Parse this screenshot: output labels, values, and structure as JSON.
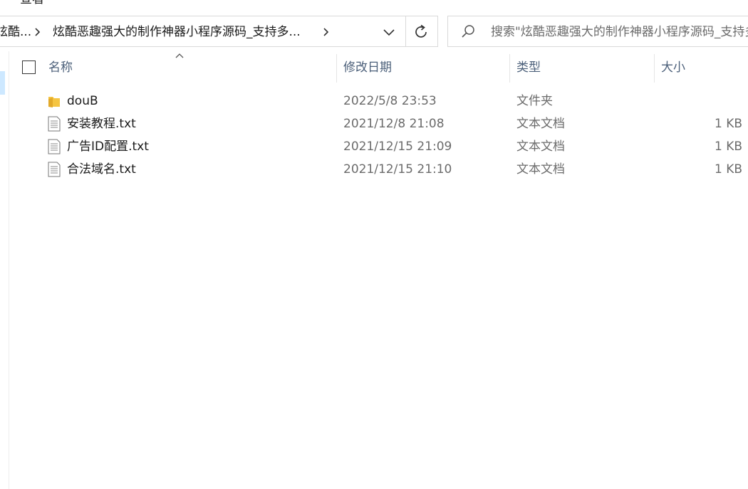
{
  "window": {
    "menu_tab": "查看"
  },
  "address_bar": {
    "crumbs": [
      "炫酷...",
      "炫酷恶趣强大的制作神器小程序源码_支持多..."
    ],
    "dropdown_icon": "chevron-down-icon",
    "refresh_icon": "refresh-icon"
  },
  "search": {
    "placeholder": "搜索\"炫酷恶趣强大的制作神器小程序源码_支持多...\""
  },
  "columns": {
    "name": "名称",
    "date": "修改日期",
    "type": "类型",
    "size": "大小"
  },
  "files": [
    {
      "name": "douB",
      "date": "2022/5/8 23:53",
      "type": "文件夹",
      "size": "",
      "icon": "folder-icon"
    },
    {
      "name": "安装教程.txt",
      "date": "2021/12/8 21:08",
      "type": "文本文档",
      "size": "1 KB",
      "icon": "text-file-icon"
    },
    {
      "name": "广告ID配置.txt",
      "date": "2021/12/15 21:09",
      "type": "文本文档",
      "size": "1 KB",
      "icon": "text-file-icon"
    },
    {
      "name": "合法域名.txt",
      "date": "2021/12/15 21:10",
      "type": "文本文档",
      "size": "1 KB",
      "icon": "text-file-icon"
    }
  ],
  "colors": {
    "header_text": "#4c607a",
    "folder": "#f5c542",
    "selection": "#cde8ff"
  }
}
